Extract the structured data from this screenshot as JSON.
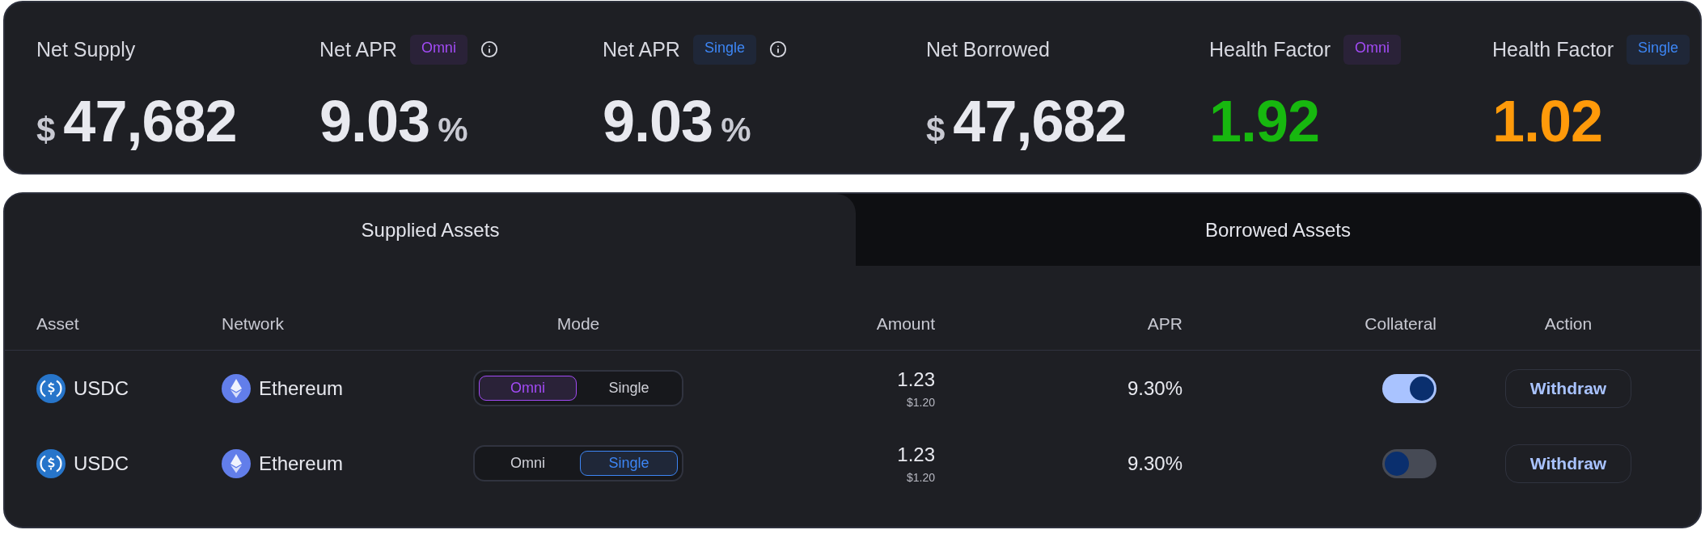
{
  "stats": [
    {
      "label": "Net Supply",
      "kind": "currency",
      "prefix": "$",
      "value": "47,682",
      "info": false
    },
    {
      "label": "Net APR",
      "kind": "percent",
      "badge": {
        "text": "Omni",
        "kind": "omni"
      },
      "value": "9.03",
      "suffix": "%",
      "info": true
    },
    {
      "label": "Net APR",
      "kind": "percent",
      "badge": {
        "text": "Single",
        "kind": "single"
      },
      "value": "9.03",
      "suffix": "%",
      "info": true
    },
    {
      "label": "Net Borrowed",
      "kind": "currency",
      "prefix": "$",
      "value": "47,682",
      "info": false
    },
    {
      "label": "Health Factor",
      "kind": "health",
      "badge": {
        "text": "Omni",
        "kind": "omni"
      },
      "value": "1.92",
      "color": "#17b80f",
      "info": false
    },
    {
      "label": "Health Factor",
      "kind": "health",
      "badge": {
        "text": "Single",
        "kind": "single"
      },
      "value": "1.02",
      "color": "#ff9a0a",
      "info": false
    }
  ],
  "tabs": [
    {
      "label": "Supplied Assets",
      "selected": true
    },
    {
      "label": "Borrowed Assets",
      "selected": false
    }
  ],
  "table": {
    "columns": [
      "Asset",
      "Network",
      "Mode",
      "Amount",
      "APR",
      "Collateral",
      "Action"
    ],
    "rows": [
      {
        "asset": "USDC",
        "network": "Ethereum",
        "modes": [
          {
            "label": "Omni",
            "kind": "omni",
            "selected": true
          },
          {
            "label": "Single",
            "kind": "single",
            "selected": false
          }
        ],
        "amount": "1.23",
        "amount_usd": "$1.20",
        "apr": "9.30%",
        "collateral": true,
        "action": "Withdraw"
      },
      {
        "asset": "USDC",
        "network": "Ethereum",
        "modes": [
          {
            "label": "Omni",
            "kind": "omni",
            "selected": false
          },
          {
            "label": "Single",
            "kind": "single",
            "selected": true
          }
        ],
        "amount": "1.23",
        "amount_usd": "$1.20",
        "apr": "9.30%",
        "collateral": false,
        "action": "Withdraw"
      }
    ]
  }
}
